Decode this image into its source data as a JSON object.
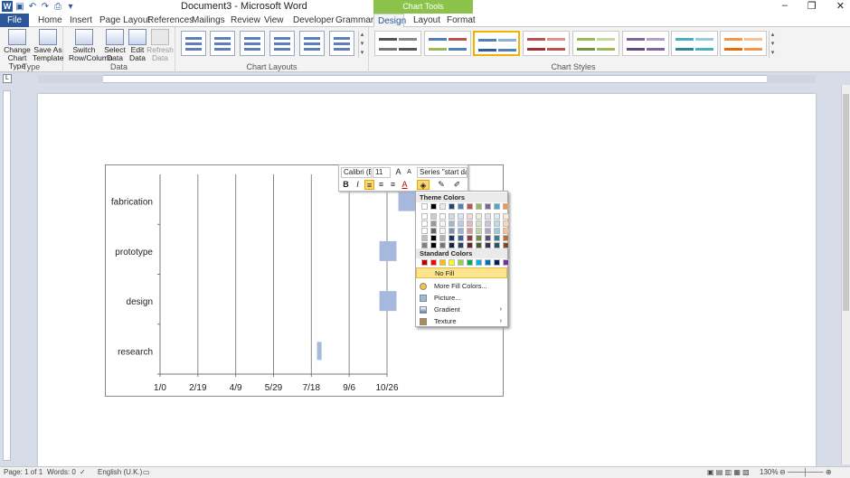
{
  "titlebar": {
    "title": "Document3 - Microsoft Word",
    "chart_tools": "Chart Tools",
    "word_icon": "W",
    "controls": [
      "–",
      "❐",
      "✕"
    ]
  },
  "tabs": {
    "file": "File",
    "items": [
      "Home",
      "Insert",
      "Page Layout",
      "References",
      "Mailings",
      "Review",
      "View",
      "Developer",
      "Grammarly"
    ],
    "design": "Design",
    "layout": "Layout",
    "format": "Format"
  },
  "ribbon": {
    "type_group": "Type",
    "change_chart_type": "Change Chart Type",
    "save_as_template": "Save As Template",
    "data_group": "Data",
    "switch_row_column": "Switch Row/Column",
    "select_data": "Select Data",
    "edit_data": "Edit Data",
    "refresh_data": "Refresh Data",
    "chart_layouts_group": "Chart Layouts",
    "chart_styles_group": "Chart Styles"
  },
  "chart_data": {
    "type": "bar",
    "orientation": "horizontal",
    "categories": [
      "fabrication",
      "prototype",
      "design",
      "research"
    ],
    "x_tick_labels": [
      "1/0",
      "2/19",
      "4/9",
      "5/29",
      "7/18",
      "9/6",
      "10/26"
    ],
    "series": [
      {
        "start_ticks_units": [
          0,
          0,
          0,
          0
        ],
        "start": [
          6.3,
          5.8,
          5.8,
          4.15
        ],
        "duration": [
          0.45,
          0.45,
          0.45,
          0.12
        ]
      }
    ],
    "grid": "vertical",
    "bar_color": "#a6b9dc"
  },
  "mini_toolbar": {
    "font": "Calibri (B",
    "size": "11",
    "series": "Series \"start dat",
    "bold": "B",
    "italic": "I",
    "font_color": "A",
    "grow": "A",
    "shrink": "A"
  },
  "color_menu": {
    "theme_colors": "Theme Colors",
    "standard_colors": "Standard Colors",
    "no_fill": "No Fill",
    "more_fill": "More Fill Colors...",
    "picture": "Picture...",
    "gradient": "Gradient",
    "texture": "Texture",
    "theme_top": [
      "#ffffff",
      "#000000",
      "#eeece1",
      "#1f497d",
      "#4f81bd",
      "#c0504d",
      "#9bbb59",
      "#8064a2",
      "#4bacc6",
      "#f79646"
    ],
    "standard": [
      "#c00000",
      "#ff0000",
      "#ffc000",
      "#ffff00",
      "#92d050",
      "#00b050",
      "#00b0f0",
      "#0070c0",
      "#002060",
      "#7030a0"
    ]
  },
  "status": {
    "page": "Page: 1 of 1",
    "words": "Words: 0",
    "language": "English (U.K.)",
    "zoom": "130%"
  }
}
